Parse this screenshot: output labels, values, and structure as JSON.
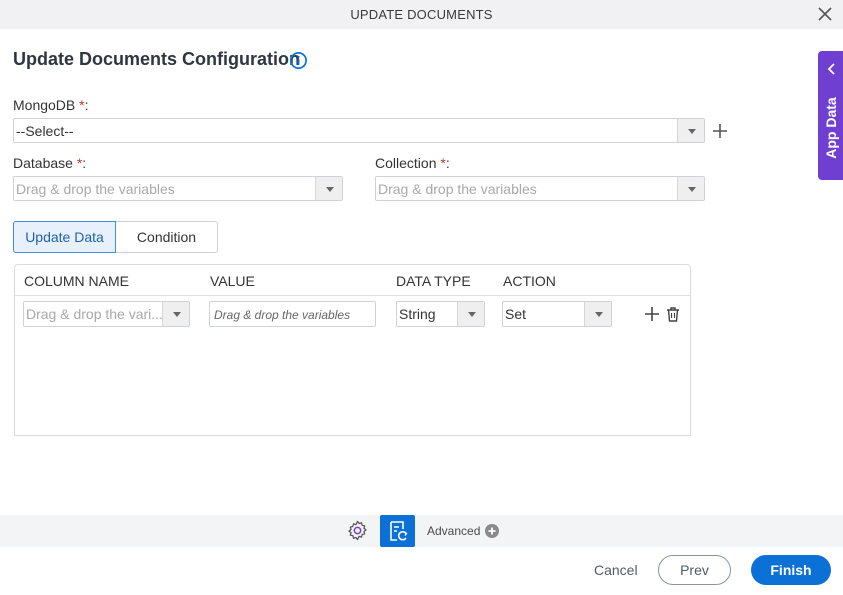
{
  "window": {
    "title": "UPDATE DOCUMENTS",
    "close_icon": "close-icon"
  },
  "heading": {
    "title": "Update Documents Configuration",
    "info_icon": "info-icon"
  },
  "fields": {
    "mongodb": {
      "label": "MongoDB",
      "required_mark": "*",
      "suffix": ":",
      "value": "--Select--"
    },
    "database": {
      "label": "Database",
      "required_mark": "*",
      "suffix": ":",
      "placeholder": "Drag & drop the variables"
    },
    "collection": {
      "label": "Collection",
      "required_mark": "*",
      "suffix": ":",
      "placeholder": "Drag & drop the variables"
    }
  },
  "tabs": [
    {
      "label": "Update Data",
      "active": true
    },
    {
      "label": "Condition",
      "active": false
    }
  ],
  "grid": {
    "columns": [
      "COLUMN NAME",
      "VALUE",
      "DATA TYPE",
      "ACTION"
    ],
    "rows": [
      {
        "column_name_placeholder": "Drag & drop the vari...",
        "value_placeholder": "Drag & drop the variables",
        "data_type": "String",
        "action": "Set"
      }
    ]
  },
  "side_panel": {
    "label": "App Data"
  },
  "toolbar": {
    "advanced_label": "Advanced"
  },
  "footer": {
    "cancel_label": "Cancel",
    "prev_label": "Prev",
    "finish_label": "Finish"
  },
  "colors": {
    "primary": "#0c71d6",
    "app_data_panel": "#6f3fd1",
    "required": "#c0392b",
    "active_tab_bg": "#e8f1fb"
  }
}
